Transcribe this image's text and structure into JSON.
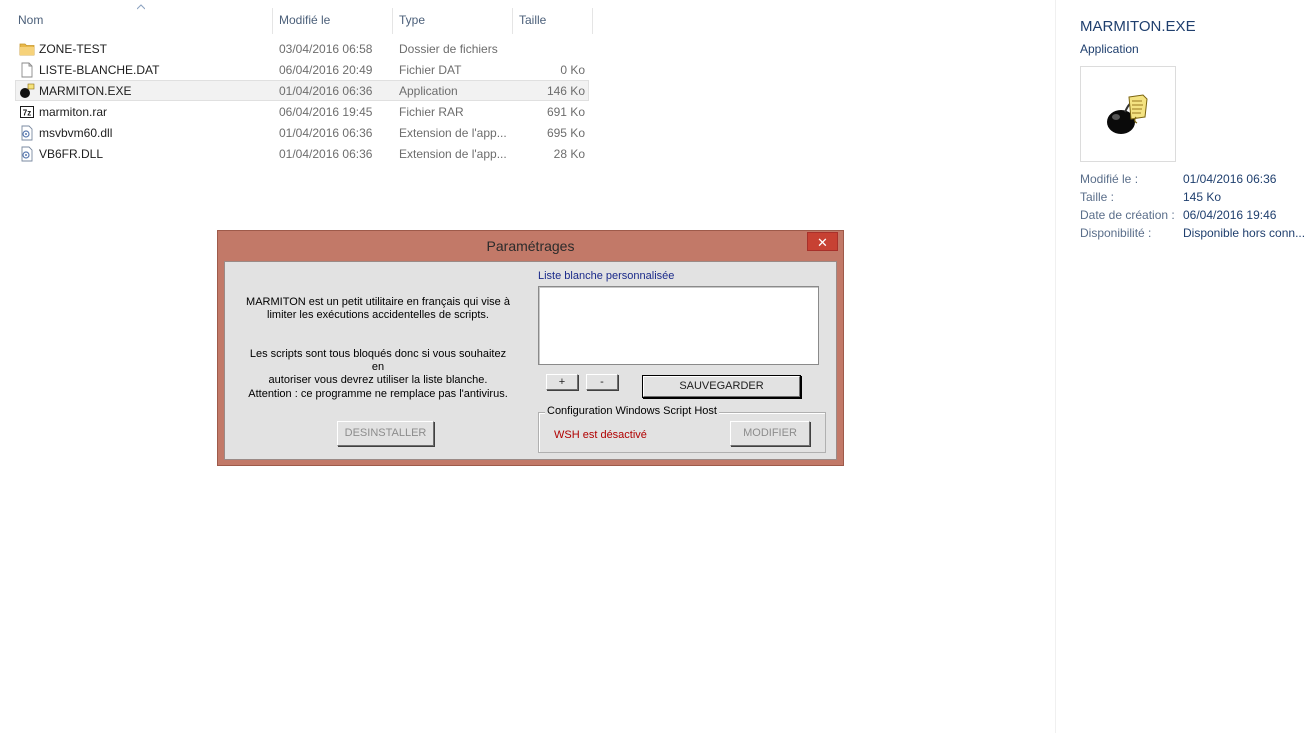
{
  "columns": {
    "name": "Nom",
    "modified": "Modifié le",
    "type": "Type",
    "size": "Taille"
  },
  "files": [
    {
      "name": "ZONE-TEST",
      "modified": "03/04/2016 06:58",
      "type": "Dossier de fichiers",
      "size": "",
      "icon": "folder-icon"
    },
    {
      "name": "LISTE-BLANCHE.DAT",
      "modified": "06/04/2016 20:49",
      "type": "Fichier DAT",
      "size": "0 Ko",
      "icon": "document-icon"
    },
    {
      "name": "MARMITON.EXE",
      "modified": "01/04/2016 06:36",
      "type": "Application",
      "size": "146 Ko",
      "icon": "bomb-icon",
      "selected": true
    },
    {
      "name": "marmiton.rar",
      "modified": "06/04/2016 19:45",
      "type": "Fichier RAR",
      "size": "691 Ko",
      "icon": "archive-icon"
    },
    {
      "name": "msvbvm60.dll",
      "modified": "01/04/2016 06:36",
      "type": "Extension de l'app...",
      "size": "695 Ko",
      "icon": "dll-icon"
    },
    {
      "name": "VB6FR.DLL",
      "modified": "01/04/2016 06:36",
      "type": "Extension de l'app...",
      "size": "28 Ko",
      "icon": "dll-icon"
    }
  ],
  "details": {
    "title": "MARMITON.EXE",
    "subtitle": "Application",
    "props": [
      {
        "label": "Modifié le :",
        "value": "01/04/2016 06:36"
      },
      {
        "label": "Taille :",
        "value": "145 Ko"
      },
      {
        "label": "Date de création :",
        "value": "06/04/2016 19:46"
      },
      {
        "label": "Disponibilité :",
        "value": "Disponible hors conn..."
      }
    ]
  },
  "dialog": {
    "title": "Paramétrages",
    "close": "✕",
    "info1_line1": "MARMITON est un petit utilitaire en français qui vise à",
    "info1_line2": "limiter les exécutions accidentelles de scripts.",
    "info2_line1": "Les scripts sont tous bloqués donc si vous souhaitez en",
    "info2_line2": "autoriser vous devrez utiliser la liste blanche.",
    "info3": "Attention : ce programme ne remplace pas l'antivirus.",
    "uninstall_label": "DESINSTALLER",
    "list_label": "Liste blanche personnalisée",
    "add_label": "+",
    "remove_label": "-",
    "save_label": "SAUVEGARDER",
    "group_title": "Configuration Windows Script Host",
    "wsh_status": "WSH est désactivé",
    "modify_label": "MODIFIER"
  },
  "colors": {
    "dialog_frame": "#c27968",
    "wsh_status": "#b00000",
    "details_title": "#1f3f6e"
  }
}
